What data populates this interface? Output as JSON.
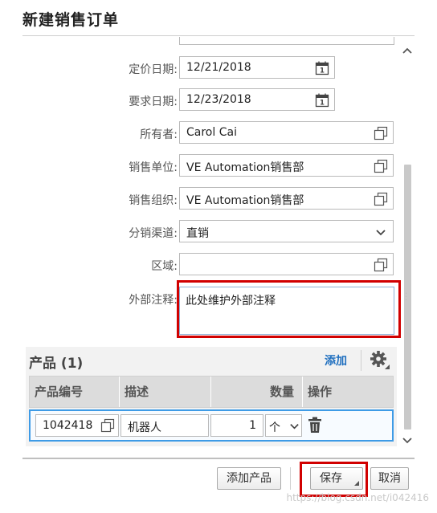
{
  "dialog": {
    "title": "新建销售订单"
  },
  "form": {
    "pricing_date": {
      "label": "定价日期:",
      "value": "12/21/2018"
    },
    "requested_date": {
      "label": "要求日期:",
      "value": "12/23/2018"
    },
    "owner": {
      "label": "所有者:",
      "value": "Carol Cai"
    },
    "sales_unit": {
      "label": "销售单位:",
      "value": "VE Automation销售部"
    },
    "sales_org": {
      "label": "销售组织:",
      "value": "VE Automation销售部"
    },
    "distribution_channel": {
      "label": "分销渠道:",
      "value": "直销"
    },
    "region": {
      "label": "区域:",
      "value": ""
    },
    "external_note": {
      "label": "外部注释:",
      "value": "此处维护外部注释"
    }
  },
  "products": {
    "title": "产品 (1)",
    "add_link": "添加",
    "columns": [
      "产品编号",
      "描述",
      "数量",
      "操作"
    ],
    "rows": [
      {
        "product_id": "1042418",
        "description": "机器人",
        "quantity": "1",
        "unit": "个"
      }
    ]
  },
  "footer": {
    "add_product": "添加产品",
    "save": "保存",
    "cancel": "取消"
  },
  "watermark": "https://blog.csdn.net/i042416",
  "colors": {
    "accent": "#1f6fbf",
    "highlight": "#d10000",
    "row_border": "#3e9be6"
  }
}
